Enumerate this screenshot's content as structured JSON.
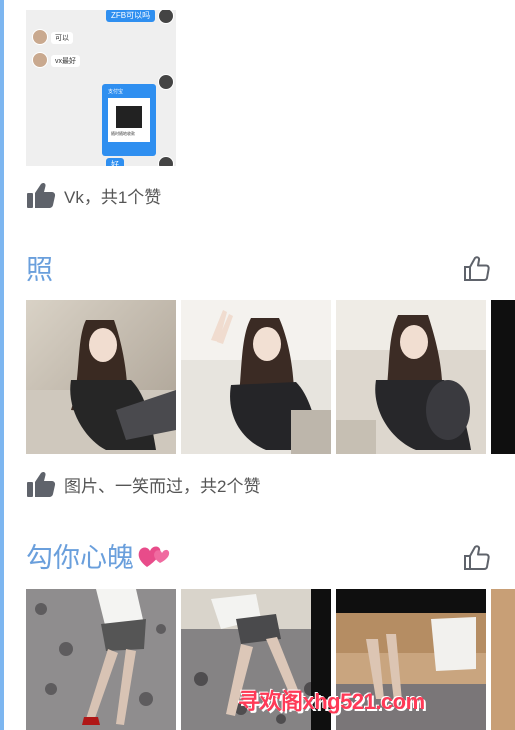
{
  "chat_preview": {
    "bubble_top": "ZFB可以吗",
    "msg_1": "可以",
    "msg_2": "vx最好",
    "pay_card_title": "随时随地收款",
    "pay_card_brand": "支付宝",
    "bubble_bottom": "好"
  },
  "post_1": {
    "likes_text": "Vk，共1个赞"
  },
  "album_1": {
    "title": "照",
    "likes_text": "图片、一笑而过，共2个赞",
    "photo_count": 4
  },
  "album_2": {
    "title": "勾你心魄",
    "title_emoji": "💕",
    "photo_count": 4
  },
  "watermark": {
    "text": "寻欢阁xhg521.com",
    "color": "#ff3a57"
  },
  "colors": {
    "accent_rail": "#7db6f0",
    "title_blue": "#6a9fdc",
    "icon_gray": "#5f636b"
  }
}
